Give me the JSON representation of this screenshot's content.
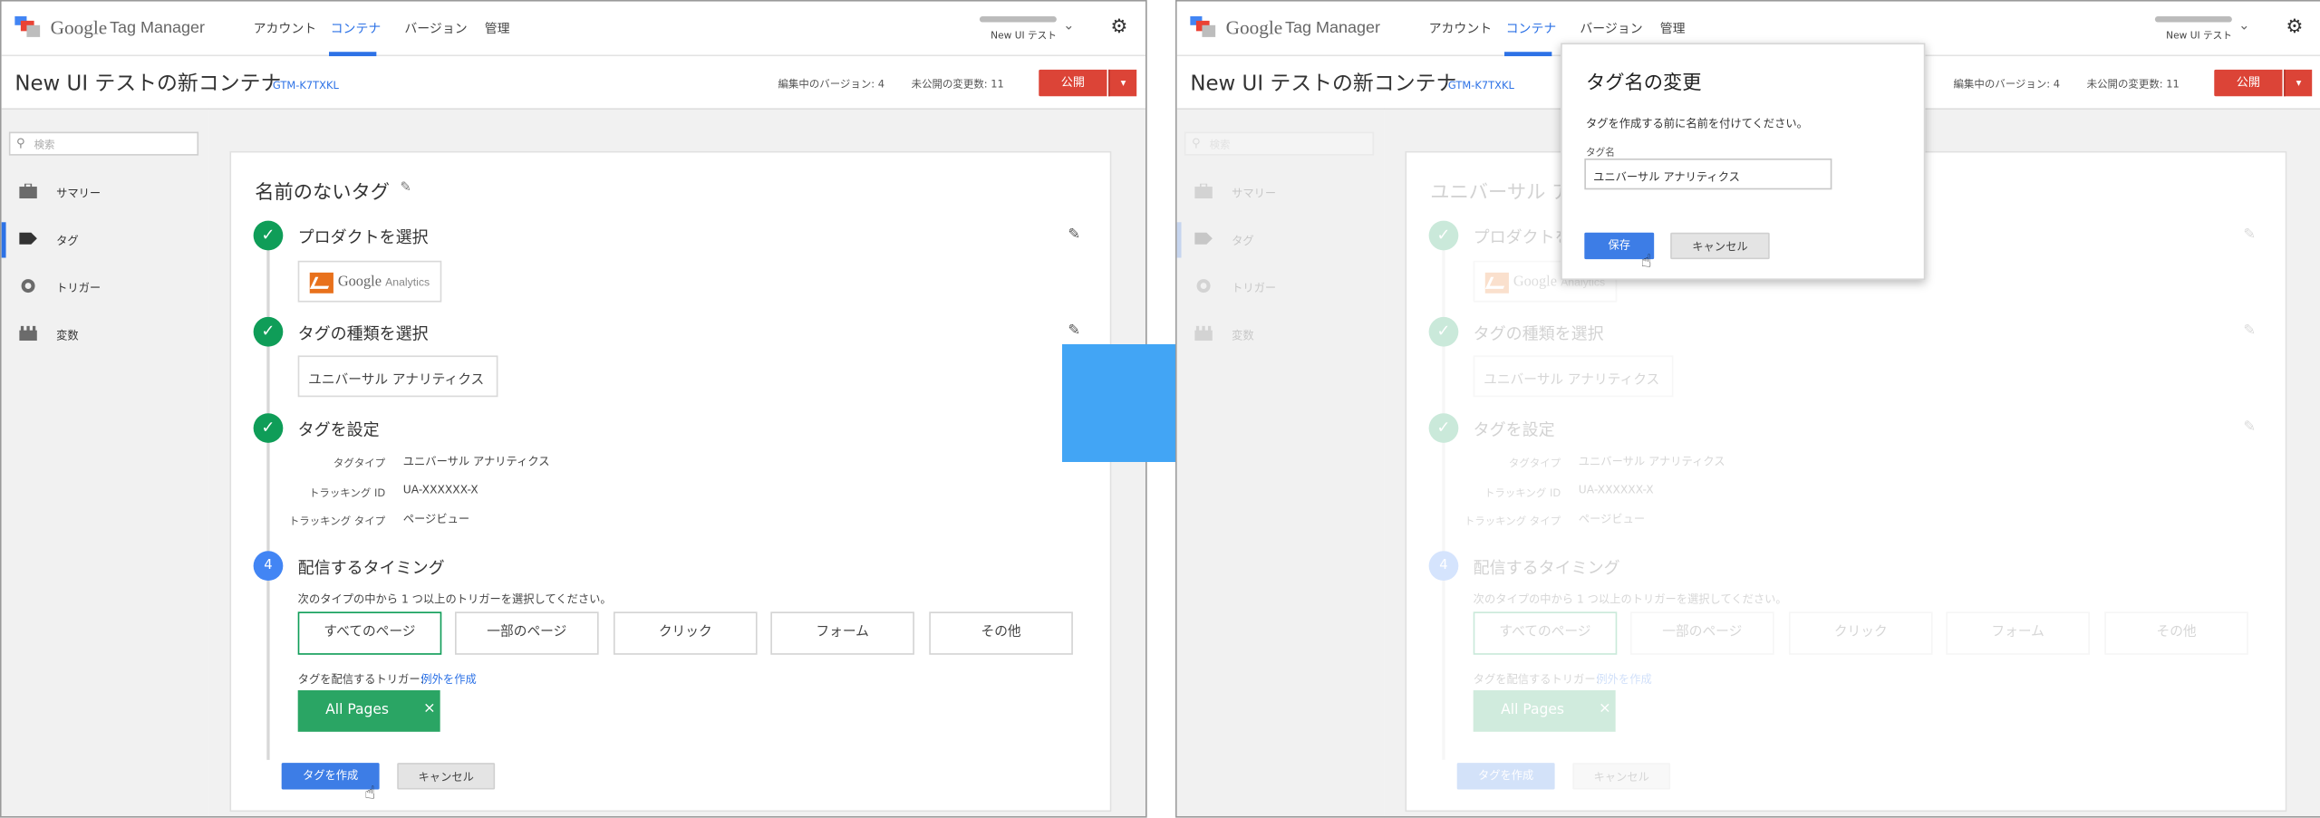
{
  "app": {
    "logo_google": "Google",
    "logo_product": "Tag Manager",
    "nav": [
      "アカウント",
      "コンテナ",
      "バージョン",
      "管理"
    ],
    "account_name": "New UI テスト",
    "container_title": "New UI テストの新コンテナ",
    "container_id": "GTM-K7TXKL",
    "editing_version": "編集中のバージョン: 4",
    "unpublished_changes": "未公開の変更数: 11",
    "publish_label": "公開",
    "colors": {
      "accent": "#2d72e6",
      "publish": "#dc4437",
      "success": "#0f9d58",
      "step": "#4285f4",
      "chip": "#2aa564"
    }
  },
  "sidebar": {
    "search_placeholder": "検索",
    "items": [
      {
        "label": "サマリー",
        "icon": "briefcase-icon"
      },
      {
        "label": "タグ",
        "icon": "tag-icon"
      },
      {
        "label": "トリガー",
        "icon": "trigger-icon"
      },
      {
        "label": "変数",
        "icon": "variables-icon"
      }
    ]
  },
  "left": {
    "tag_title": "名前のないタグ"
  },
  "right": {
    "tag_title": "ユニバーサル ア"
  },
  "editor": {
    "steps": [
      {
        "title": "プロダクトを選択"
      },
      {
        "title": "タグの種類を選択"
      },
      {
        "title": "タグを設定"
      },
      {
        "number": "4",
        "title": "配信するタイミング"
      }
    ],
    "product": {
      "google": "Google",
      "analytics": "Analytics"
    },
    "tag_type_value": "ユニバーサル アナリティクス",
    "config": [
      {
        "label": "タグタイプ",
        "value": "ユニバーサル アナリティクス"
      },
      {
        "label": "トラッキング ID",
        "value": "UA-XXXXXX-X"
      },
      {
        "label": "トラッキング タイプ",
        "value": "ページビュー"
      }
    ],
    "trigger_help": "次のタイプの中から 1 つ以上のトリガーを選択してください。",
    "trigger_types": [
      "すべてのページ",
      "一部のページ",
      "クリック",
      "フォーム",
      "その他"
    ],
    "firing_label": "タグを配信するトリガー:",
    "exception_link": "例外を作成",
    "chip_label": "All Pages",
    "chip_close": "×",
    "create_button": "タグを作成",
    "cancel_button": "キャンセル"
  },
  "dialog": {
    "title": "タグ名の変更",
    "description": "タグを作成する前に名前を付けてください。",
    "field_label": "タグ名",
    "field_value": "ユニバーサル アナリティクス",
    "save_button": "保存",
    "cancel_button": "キャンセル"
  },
  "arrow": {
    "color": "#42a5f5",
    "icon": "arrow-right-icon"
  }
}
